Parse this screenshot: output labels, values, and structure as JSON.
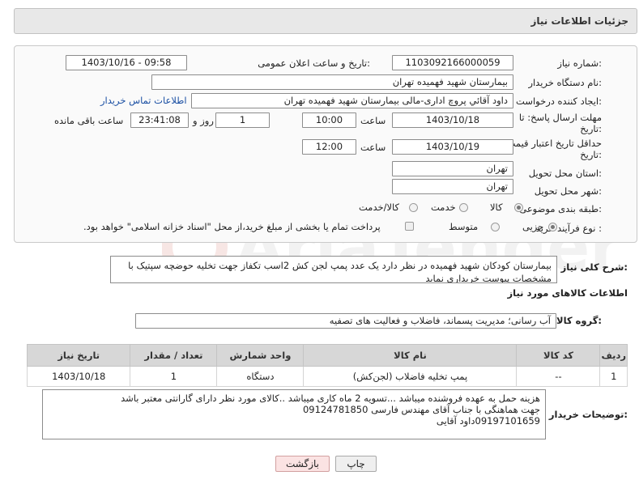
{
  "panel_title": "جزئیات اطلاعات نیاز",
  "form": {
    "need_number_label": "شماره نیاز:",
    "need_number": "1103092166000059",
    "announce_label": "تاریخ و ساعت اعلان عمومی:",
    "announce_value": "1403/10/16 - 09:58",
    "buyer_org_label": "نام دستگاه خریدار:",
    "buyer_org": "بیمارستان شهید فهمیده تهران",
    "requester_label": "ایجاد کننده درخواست:",
    "requester": "داود آقائي پروچ اداری-مالی بیمارستان شهید فهمیده تهران",
    "contact_link": "اطلاعات تماس خریدار",
    "deadline_label_1": "مهلت ارسال پاسخ: تا",
    "deadline_label_2": "تاریخ:",
    "deadline_date": "1403/10/18",
    "time_word": "ساعت",
    "deadline_time": "10:00",
    "days_value": "1",
    "days_word": "روز و",
    "remaining_time": "23:41:08",
    "remaining_word": "ساعت باقی مانده",
    "validity_label_1": "حداقل تاریخ اعتبار قیمت: تا",
    "validity_label_2": "تاریخ:",
    "validity_date": "1403/10/19",
    "validity_time": "12:00",
    "province_label": "استان محل تحویل:",
    "province": "تهران",
    "city_label": "شهر محل تحویل:",
    "city": "تهران",
    "category_label": "طبقه بندی موضوعی:",
    "category_options": [
      "کالا",
      "خدمت",
      "کالا/خدمت"
    ],
    "process_label": "نوع فرآیند خرید :",
    "process_options": [
      "جزیی",
      "متوسط"
    ],
    "process_note": "پرداخت تمام یا بخشی از مبلغ خرید،از محل \"اسناد خزانه اسلامی\" خواهد بود."
  },
  "description": {
    "label": "شرح کلی نیاز:",
    "text": "بیمارستان کودکان شهید فهمیده در نظر دارد یک عدد پمپ لجن کش 2اسب تکفاز جهت تخلیه حوضچه سپتیک با مشخصات پیوست خریداری نماید"
  },
  "goods_section_title": "اطلاعات کالاهای مورد نیاز",
  "goods_group": {
    "label": "گروه کالا:",
    "value": "آب رسانی؛ مدیریت پسماند، فاضلاب و فعالیت های تصفیه"
  },
  "table": {
    "headers": [
      "ردیف",
      "کد کالا",
      "نام کالا",
      "واحد شمارش",
      "تعداد / مقدار",
      "تاریخ نیاز"
    ],
    "rows": [
      [
        "1",
        "--",
        "پمپ تخلیه فاضلاب (لجن‌کش)",
        "دستگاه",
        "1",
        "1403/10/18"
      ]
    ]
  },
  "buyer_notes": {
    "label": "توضیحات خریدار:",
    "lines": [
      "هزینه حمل به عهده فروشنده میباشد ...تسویه 2 ماه کاری میباشد ..کالای مورد نظر دارای گارانتی معتبر باشد",
      "جهت هماهنگی با جناب آقای مهندس فارسی 09124781850",
      "09197101659داود آقایی"
    ]
  },
  "buttons": {
    "print": "چاپ",
    "back": "بازگشت"
  },
  "watermark_text": "AriaTender.neT",
  "colors": {
    "link": "#1a4fa3",
    "header_bg": "#e8e8e8",
    "table_header_bg": "#d7d7d7",
    "back_button_bg": "#fbe3e3"
  }
}
